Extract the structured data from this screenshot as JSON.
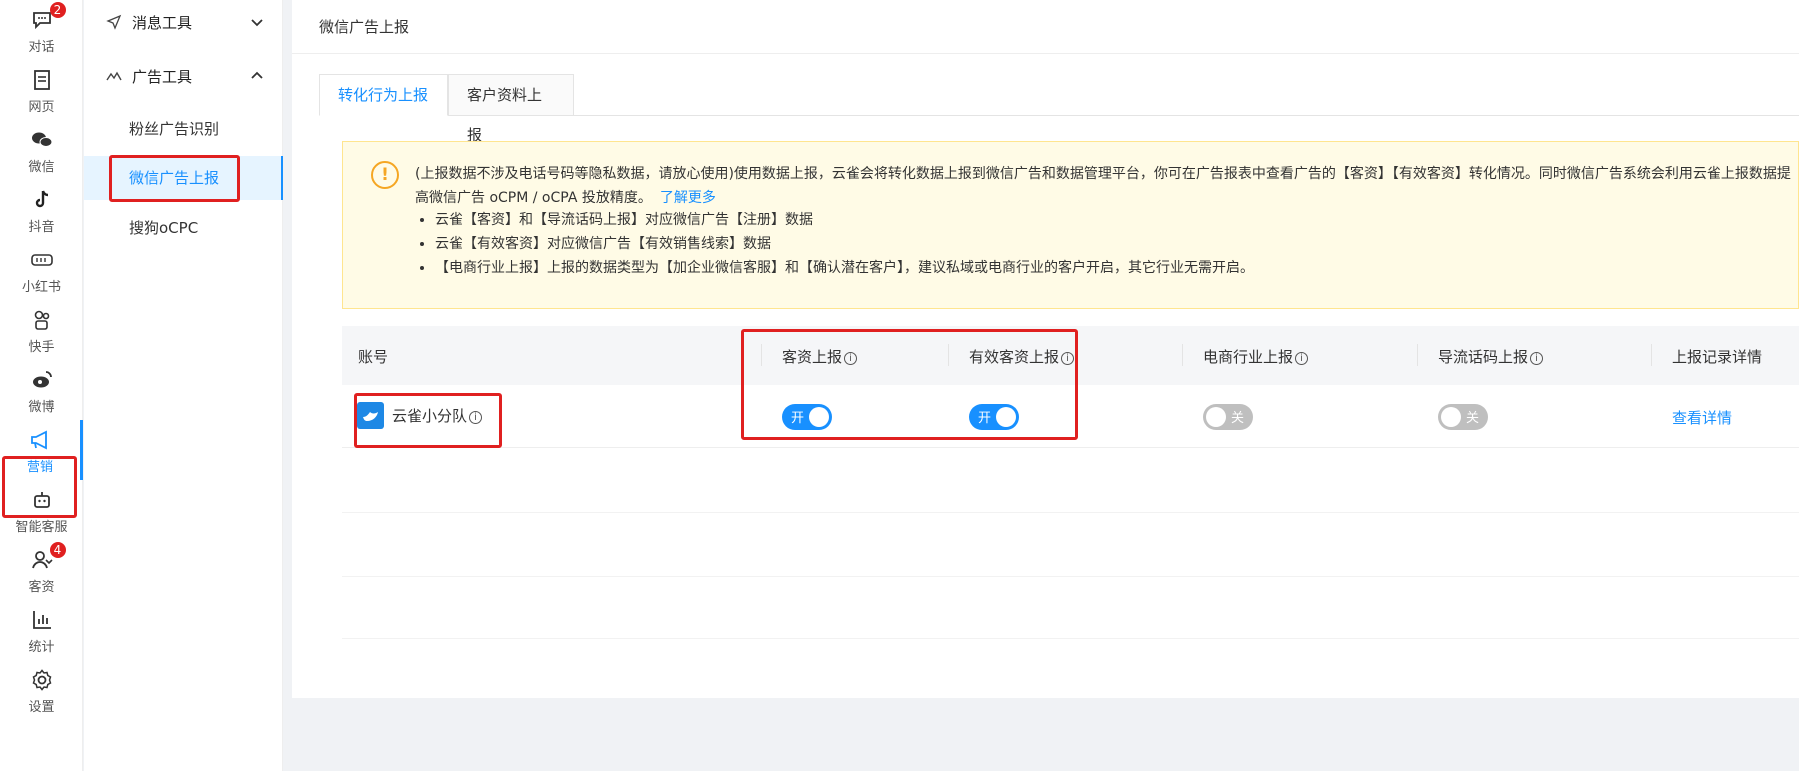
{
  "rail": {
    "items": [
      {
        "label": "对话",
        "badge": "2"
      },
      {
        "label": "网页"
      },
      {
        "label": "微信"
      },
      {
        "label": "抖音"
      },
      {
        "label": "小红书"
      },
      {
        "label": "快手"
      },
      {
        "label": "微博"
      },
      {
        "label": "营销"
      },
      {
        "label": "智能客服"
      },
      {
        "label": "客资",
        "badge": "4"
      },
      {
        "label": "统计"
      },
      {
        "label": "设置"
      }
    ],
    "active": "营销"
  },
  "subnav": {
    "groups": [
      {
        "label": "消息工具",
        "expanded": false
      },
      {
        "label": "广告工具",
        "expanded": true
      }
    ],
    "items": [
      {
        "label": "粉丝广告识别"
      },
      {
        "label": "微信广告上报"
      },
      {
        "label": "搜狗oCPC"
      }
    ],
    "active": "微信广告上报"
  },
  "page": {
    "title": "微信广告上报"
  },
  "tabs": [
    {
      "label": "转化行为上报"
    },
    {
      "label": "客户资料上报"
    }
  ],
  "active_tab": "转化行为上报",
  "notice": {
    "text": "(上报数据不涉及电话号码等隐私数据，请放心使用)使用数据上报，云雀会将转化数据上报到微信广告和数据管理平台，你可在广告报表中查看广告的【客资】【有效客资】转化情况。同时微信广告系统会利用云雀上报数据提高微信广告 oCPM / oCPA 投放精度。",
    "link": "了解更多",
    "bullets": [
      "云雀【客资】和【导流话码上报】对应微信广告【注册】数据",
      "云雀【有效客资】对应微信广告【有效销售线索】数据",
      "【电商行业上报】上报的数据类型为【加企业微信客服】和【确认潜在客户】，建议私域或电商行业的客户开启，其它行业无需开启。"
    ]
  },
  "table": {
    "columns": [
      "账号",
      "客资上报",
      "有效客资上报",
      "电商行业上报",
      "导流话码上报",
      "上报记录详情"
    ],
    "rows": [
      {
        "account": "云雀小分队",
        "switch_1": "开",
        "switch_2": "开",
        "switch_3": "关",
        "switch_4": "关",
        "detail_link": "查看详情"
      }
    ]
  },
  "colors": {
    "accent": "#1890ff",
    "highlight": "#e02020",
    "notice_bg": "#fffbe6"
  },
  "icons": [
    "chat-icon",
    "webpage-icon",
    "wechat-icon",
    "douyin-icon",
    "xiaohongshu-icon",
    "kuaishou-icon",
    "weibo-icon",
    "megaphone-icon",
    "robot-icon",
    "customer-icon",
    "stats-icon",
    "gear-icon"
  ]
}
